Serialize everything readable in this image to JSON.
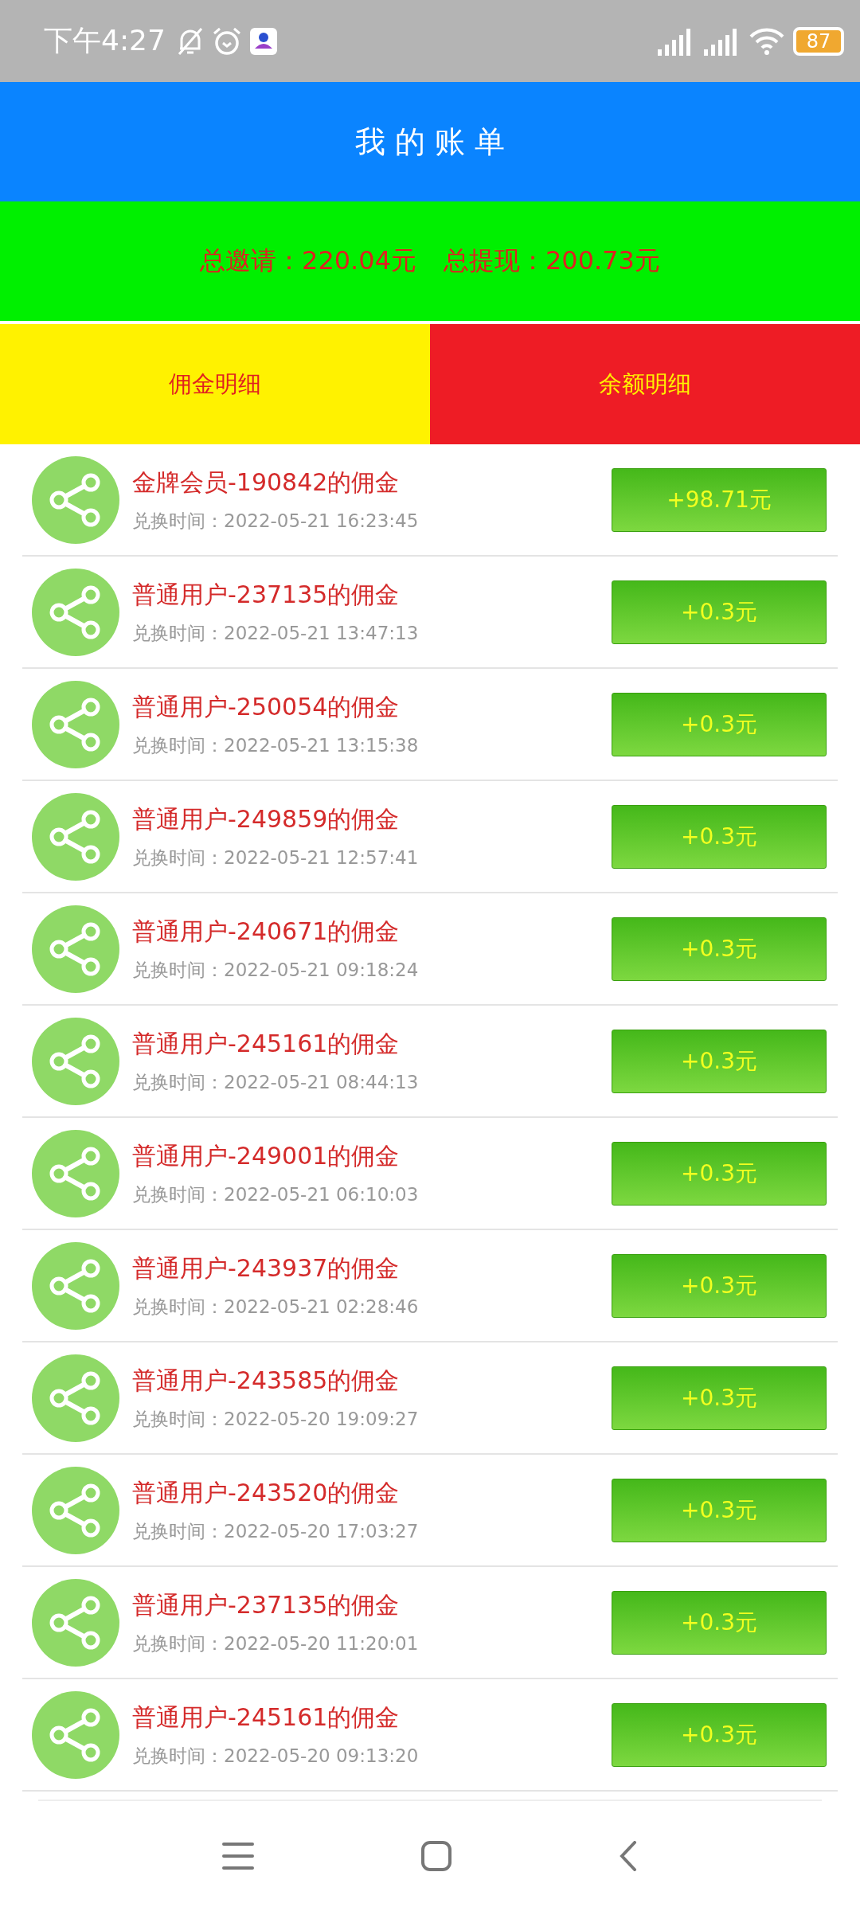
{
  "status_bar": {
    "time": "下午4:27",
    "battery": "87"
  },
  "header": {
    "title": "我 的 账 单"
  },
  "summary": {
    "invite_label": "总邀请：",
    "invite_value": "220.04元",
    "withdraw_label": "总提现：",
    "withdraw_value": "200.73元"
  },
  "tabs": [
    {
      "label": "佣金明细",
      "color": "#fff200"
    },
    {
      "label": "余额明细",
      "color": "#ee1c25"
    }
  ],
  "records": [
    {
      "title": "金牌会员-190842的佣金",
      "time": "兑换时间：2022-05-21 16:23:45",
      "amount": "+98.71元"
    },
    {
      "title": "普通用户-237135的佣金",
      "time": "兑换时间：2022-05-21 13:47:13",
      "amount": "+0.3元"
    },
    {
      "title": "普通用户-250054的佣金",
      "time": "兑换时间：2022-05-21 13:15:38",
      "amount": "+0.3元"
    },
    {
      "title": "普通用户-249859的佣金",
      "time": "兑换时间：2022-05-21 12:57:41",
      "amount": "+0.3元"
    },
    {
      "title": "普通用户-240671的佣金",
      "time": "兑换时间：2022-05-21 09:18:24",
      "amount": "+0.3元"
    },
    {
      "title": "普通用户-245161的佣金",
      "time": "兑换时间：2022-05-21 08:44:13",
      "amount": "+0.3元"
    },
    {
      "title": "普通用户-249001的佣金",
      "time": "兑换时间：2022-05-21 06:10:03",
      "amount": "+0.3元"
    },
    {
      "title": "普通用户-243937的佣金",
      "time": "兑换时间：2022-05-21 02:28:46",
      "amount": "+0.3元"
    },
    {
      "title": "普通用户-243585的佣金",
      "time": "兑换时间：2022-05-20 19:09:27",
      "amount": "+0.3元"
    },
    {
      "title": "普通用户-243520的佣金",
      "time": "兑换时间：2022-05-20 17:03:27",
      "amount": "+0.3元"
    },
    {
      "title": "普通用户-237135的佣金",
      "time": "兑换时间：2022-05-20 11:20:01",
      "amount": "+0.3元"
    },
    {
      "title": "普通用户-245161的佣金",
      "time": "兑换时间：2022-05-20 09:13:20",
      "amount": "+0.3元"
    }
  ]
}
